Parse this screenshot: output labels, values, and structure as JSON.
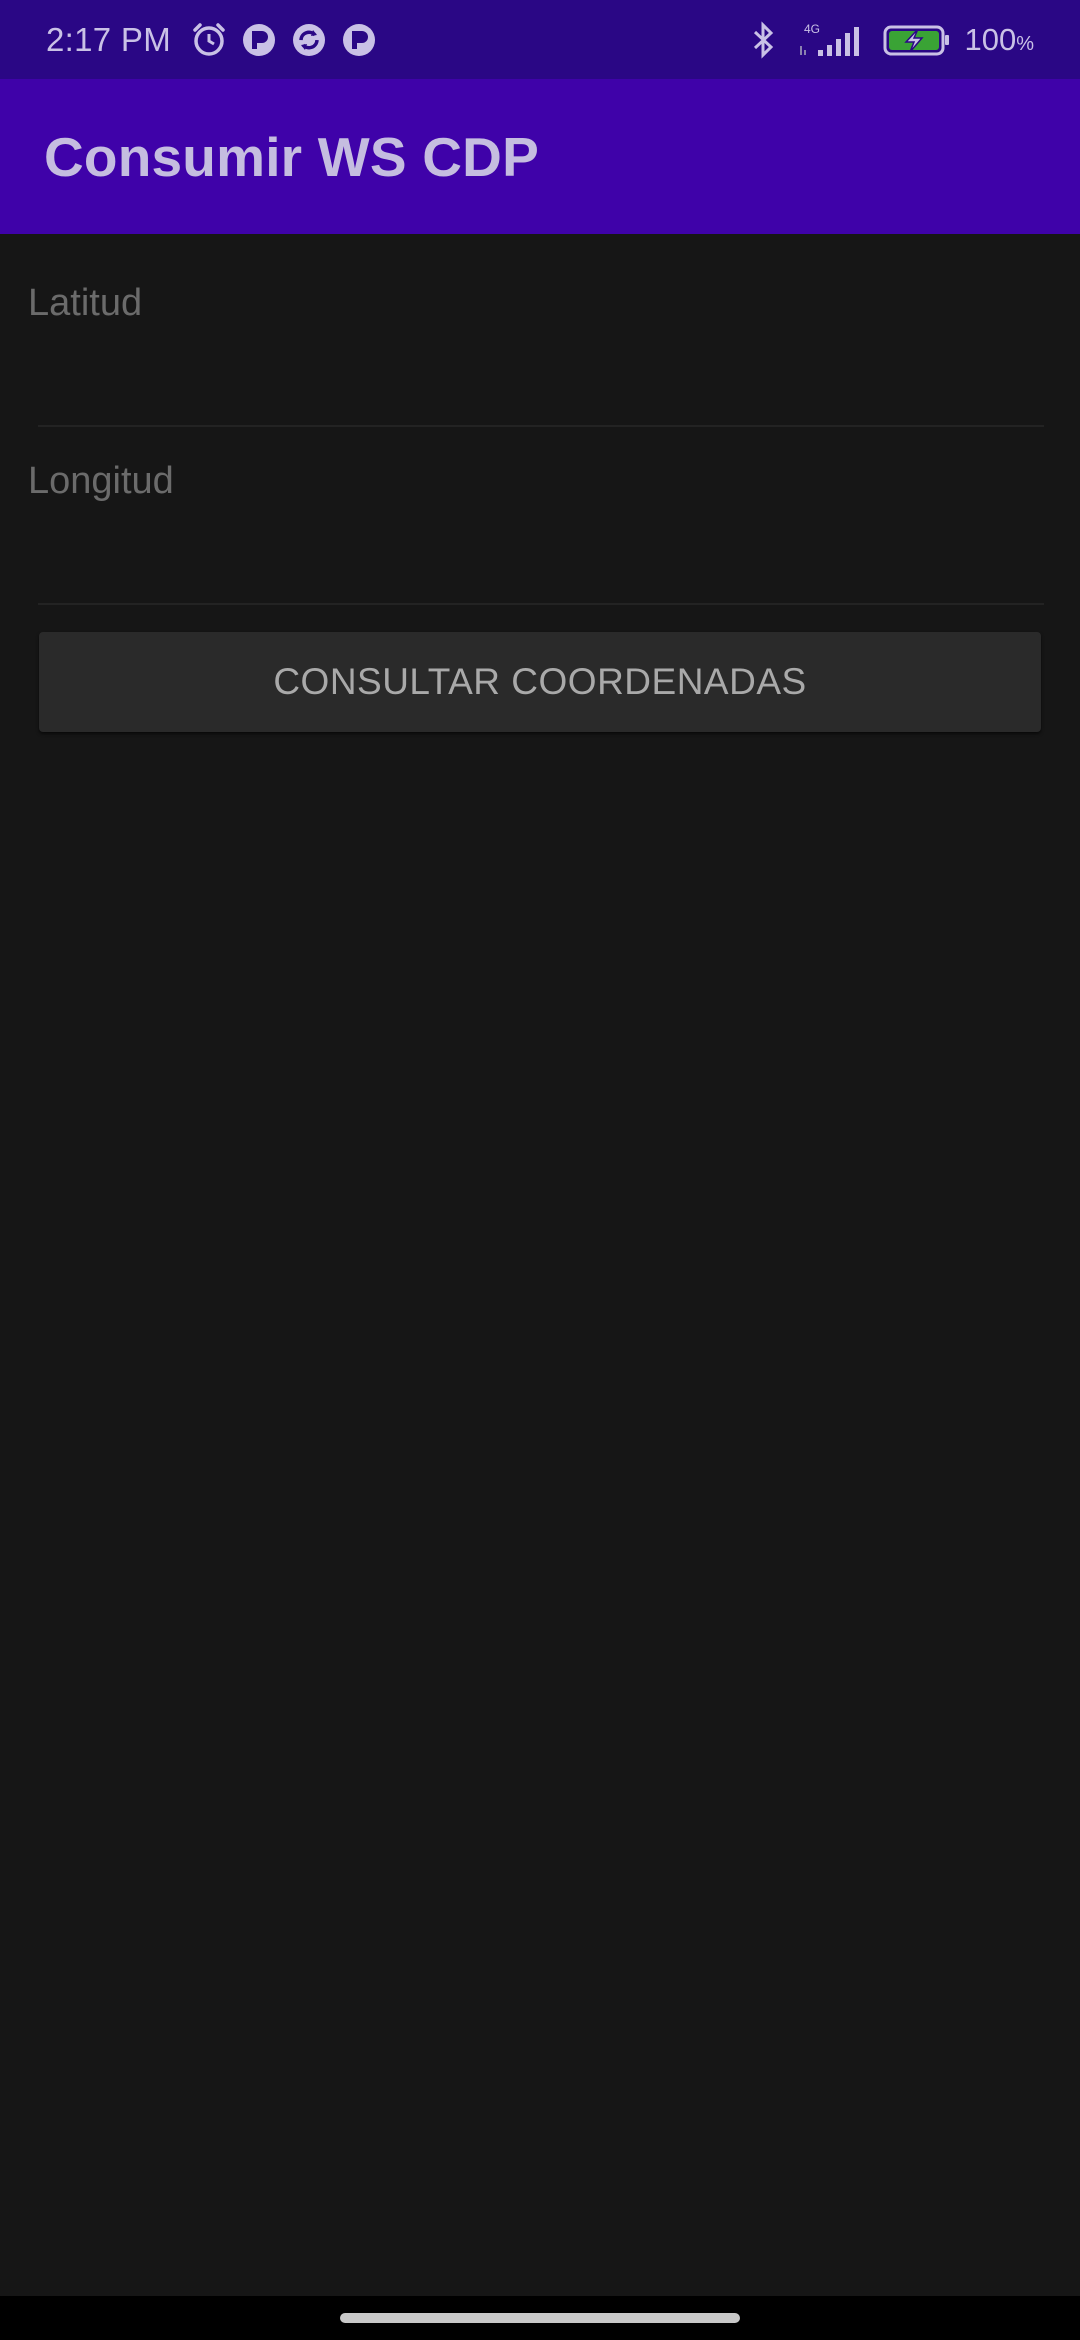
{
  "status_bar": {
    "time": "2:17 PM",
    "network": "4G",
    "battery_percent": "100",
    "battery_unit": "%",
    "icons": [
      "alarm-icon",
      "app-notification-icon",
      "sync-notification-icon",
      "app-notification-icon",
      "bluetooth-icon",
      "signal-icon",
      "battery-charging-icon"
    ]
  },
  "app_bar": {
    "title": "Consumir WS CDP"
  },
  "form": {
    "latitude": {
      "placeholder": "Latitud",
      "value": ""
    },
    "longitude": {
      "placeholder": "Longitud",
      "value": ""
    },
    "submit_label": "CONSULTAR COORDENADAS"
  },
  "colors": {
    "status_bar": "#2a0785",
    "app_bar": "#3f02a9",
    "background": "#161616",
    "button": "#2a2a2a",
    "battery_fill": "#3aa335"
  }
}
